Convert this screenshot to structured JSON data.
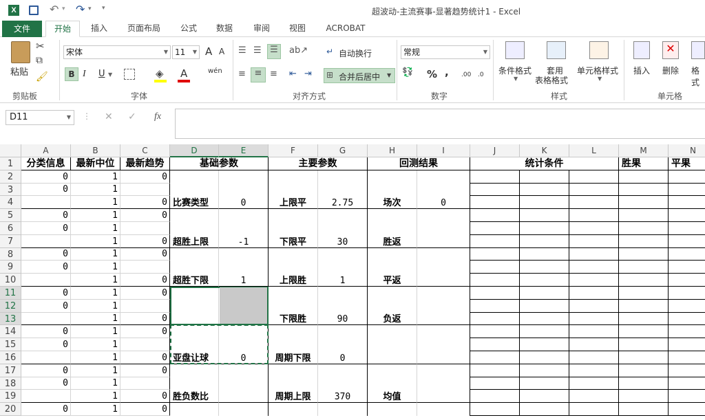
{
  "title": "超波动-主流赛事-显著趋势统计1 - Excel",
  "tabs": [
    "文件",
    "开始",
    "插入",
    "页面布局",
    "公式",
    "数据",
    "审阅",
    "视图",
    "ACROBAT"
  ],
  "active_tab": "开始",
  "ribbon": {
    "clipboard": {
      "paste": "粘贴",
      "label": "剪贴板"
    },
    "font": {
      "name": "宋体",
      "size": "11",
      "label": "字体",
      "bold": "B",
      "italic": "I",
      "underline": "U",
      "grow": "A",
      "shrink": "A",
      "wen": "wén"
    },
    "alignment": {
      "wrap": "自动换行",
      "merge": "合并后居中",
      "label": "对齐方式"
    },
    "number": {
      "format": "常规",
      "percent": "%",
      "comma": ",",
      "inc": ".00",
      "dec": ".0",
      "label": "数字"
    },
    "styles": {
      "cond": "条件格式",
      "table": "套用",
      "table2": "表格格式",
      "cell": "单元格样式",
      "label": "样式"
    },
    "cells": {
      "insert": "插入",
      "delete": "删除",
      "format": "格式",
      "label": "单元格"
    }
  },
  "namebox": "D11",
  "fx": "fx",
  "columns": [
    "A",
    "B",
    "C",
    "D",
    "E",
    "F",
    "G",
    "H",
    "I",
    "J",
    "K",
    "L",
    "M",
    "N"
  ],
  "rows": [
    "1",
    "2",
    "3",
    "4",
    "5",
    "6",
    "7",
    "8",
    "9",
    "10",
    "11",
    "12",
    "13",
    "14",
    "15",
    "16",
    "17",
    "18",
    "19",
    "20"
  ],
  "headers": {
    "a": "分类信息",
    "b": "最新中位",
    "c": "最新趋势",
    "de": "基础参数",
    "fg": "主要参数",
    "hi": "回测结果",
    "jl": "统计条件",
    "m": "胜果",
    "n": "平果"
  },
  "colA": {
    "2": "0",
    "3": "0",
    "5": "0",
    "6": "0",
    "8": "0",
    "9": "0",
    "11": "0",
    "12": "0",
    "14": "0",
    "15": "0",
    "17": "0",
    "18": "0",
    "20": "0"
  },
  "colB": {
    "2": "1",
    "3": "1",
    "4": "1",
    "5": "1",
    "6": "1",
    "7": "1",
    "8": "1",
    "9": "1",
    "10": "1",
    "11": "1",
    "12": "1",
    "13": "1",
    "14": "1",
    "15": "1",
    "16": "1",
    "17": "1",
    "18": "1",
    "19": "1",
    "20": "1"
  },
  "colC": {
    "2": "0",
    "4": "0",
    "5": "0",
    "7": "0",
    "8": "0",
    "10": "0",
    "11": "0",
    "13": "0",
    "14": "0",
    "16": "0",
    "17": "0",
    "19": "0",
    "20": "0"
  },
  "params": {
    "d1": "比赛类型",
    "e1": "0",
    "d2": "超胜上限",
    "e2": "-1",
    "d3": "超胜下限",
    "e3": "1",
    "d5": "亚盘让球",
    "e5": "0",
    "d6": "胜负数比",
    "f1": "上限平",
    "g1": "2.75",
    "f2": "下限平",
    "g2": "30",
    "f3": "上限胜",
    "g3": "1",
    "f4": "下限胜",
    "g4": "90",
    "f5": "周期下限",
    "g5": "0",
    "f6": "周期上限",
    "g6": "370",
    "h1": "场次",
    "i1": "0",
    "h2": "胜返",
    "h3": "平返",
    "h4": "负返",
    "h6": "均值"
  }
}
